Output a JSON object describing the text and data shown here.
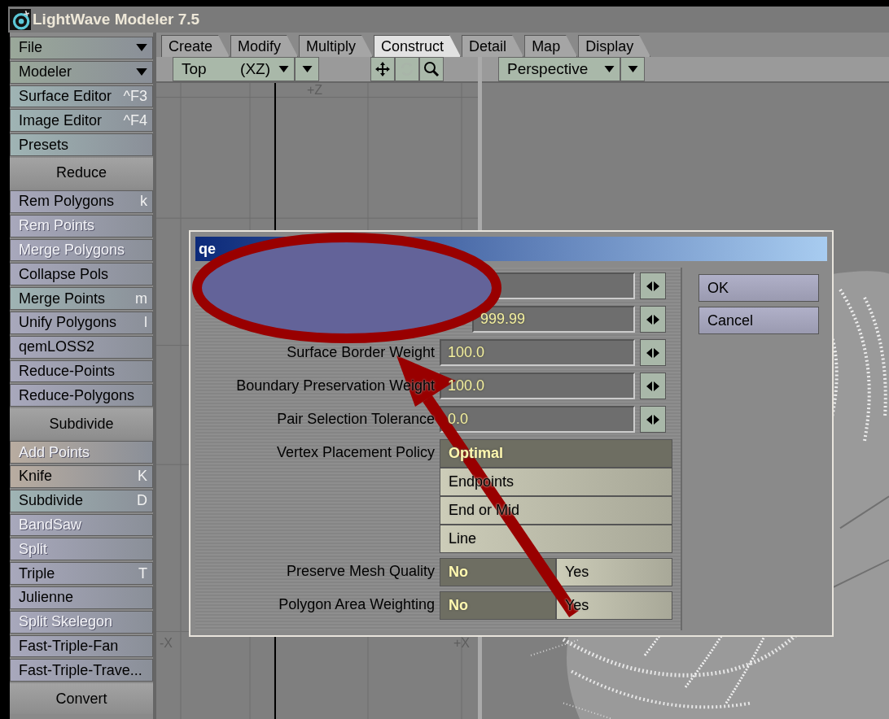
{
  "window": {
    "title": "LightWave Modeler 7.5"
  },
  "sidebar": {
    "items": [
      {
        "kind": "dropdown",
        "label": "File",
        "color": "#9aa89a",
        "disabled": false
      },
      {
        "kind": "dropdown",
        "label": "Modeler",
        "color": "#9aa89a",
        "disabled": false
      },
      {
        "kind": "item",
        "label": "Surface Editor",
        "shortcut": "^F3",
        "color": "#9fb4b4",
        "disabled": false
      },
      {
        "kind": "item",
        "label": "Image Editor",
        "shortcut": "^F4",
        "color": "#9fb4b4",
        "disabled": false
      },
      {
        "kind": "item",
        "label": "Presets",
        "color": "#9fb4b4",
        "disabled": false
      },
      {
        "kind": "header",
        "label": "Reduce"
      },
      {
        "kind": "item",
        "label": "Rem Polygons",
        "shortcut": "k",
        "color": "#a8a8bc",
        "disabled": false
      },
      {
        "kind": "item",
        "label": "Rem Points",
        "color": "#a8a8bc",
        "disabled": true
      },
      {
        "kind": "item",
        "label": "Merge Polygons",
        "color": "#a8a8bc",
        "disabled": true
      },
      {
        "kind": "item",
        "label": "Collapse Pols",
        "color": "#a8a8bc",
        "disabled": false
      },
      {
        "kind": "item",
        "label": "Merge Points",
        "shortcut": "m",
        "color": "#9fb4b4",
        "disabled": false
      },
      {
        "kind": "item",
        "label": "Unify Polygons",
        "shortcut": "l",
        "color": "#a8a8bc",
        "disabled": false
      },
      {
        "kind": "item",
        "label": "qemLOSS2",
        "color": "#a8a8bc",
        "disabled": false
      },
      {
        "kind": "item",
        "label": "Reduce-Points",
        "color": "#a8a8bc",
        "disabled": false
      },
      {
        "kind": "item",
        "label": "Reduce-Polygons",
        "color": "#a8a8bc",
        "disabled": false
      },
      {
        "kind": "header",
        "label": "Subdivide"
      },
      {
        "kind": "item",
        "label": "Add Points",
        "color": "#b8aca0",
        "disabled": true
      },
      {
        "kind": "item",
        "label": "Knife",
        "shortcut": "K",
        "color": "#b8aca0",
        "disabled": false
      },
      {
        "kind": "item",
        "label": "Subdivide",
        "shortcut": "D",
        "color": "#9fb4b4",
        "disabled": false
      },
      {
        "kind": "item",
        "label": "BandSaw",
        "color": "#a8a8bc",
        "disabled": true
      },
      {
        "kind": "item",
        "label": "Split",
        "color": "#a8a8bc",
        "disabled": true
      },
      {
        "kind": "item",
        "label": "Triple",
        "shortcut": "T",
        "color": "#a8a8bc",
        "disabled": false
      },
      {
        "kind": "item",
        "label": "Julienne",
        "color": "#a8a8bc",
        "disabled": false
      },
      {
        "kind": "item",
        "label": "Split Skelegon",
        "color": "#a8a8bc",
        "disabled": true
      },
      {
        "kind": "item",
        "label": "Fast-Triple-Fan",
        "color": "#a8a8bc",
        "disabled": false
      },
      {
        "kind": "item",
        "label": "Fast-Triple-Trave...",
        "color": "#a8a8bc",
        "disabled": false
      },
      {
        "kind": "header",
        "label": "Convert"
      }
    ]
  },
  "tabs": [
    {
      "label": "Create",
      "selected": false
    },
    {
      "label": "Modify",
      "selected": false
    },
    {
      "label": "Multiply",
      "selected": false
    },
    {
      "label": "Construct",
      "selected": true
    },
    {
      "label": "Detail",
      "selected": false
    },
    {
      "label": "Map",
      "selected": false
    },
    {
      "label": "Display",
      "selected": false
    }
  ],
  "viewports": [
    {
      "view": "Top",
      "axes": "(XZ)",
      "labels": {
        "top": "+Z",
        "left": "-X",
        "right": "+X"
      },
      "kind": "grid"
    },
    {
      "view": "Perspective",
      "kind": "perspective"
    }
  ],
  "dialog": {
    "title": "qe",
    "rows": [
      {
        "kind": "number"
      },
      {
        "kind": "number",
        "value": "999.99"
      },
      {
        "kind": "number",
        "label": "Surface Border Weight",
        "value": "100.0"
      },
      {
        "kind": "number",
        "label": "Boundary Preservation Weight",
        "value": "100.0"
      },
      {
        "kind": "number",
        "label": "Pair Selection Tolerance",
        "value": "0.0"
      },
      {
        "kind": "choice",
        "label": "Vertex Placement Policy",
        "options": [
          {
            "label": "Optimal",
            "selected": true
          },
          {
            "label": "Endpoints",
            "selected": false
          },
          {
            "label": "End or Mid",
            "selected": false
          },
          {
            "label": "Line",
            "selected": false
          }
        ]
      },
      {
        "kind": "toggle",
        "label": "Preserve Mesh Quality",
        "options": [
          {
            "label": "No",
            "selected": true
          },
          {
            "label": "Yes",
            "selected": false
          }
        ]
      },
      {
        "kind": "toggle",
        "label": "Polygon Area Weighting",
        "options": [
          {
            "label": "No",
            "selected": true
          },
          {
            "label": "Yes",
            "selected": false
          }
        ]
      }
    ],
    "buttons": [
      "OK",
      "Cancel"
    ]
  }
}
